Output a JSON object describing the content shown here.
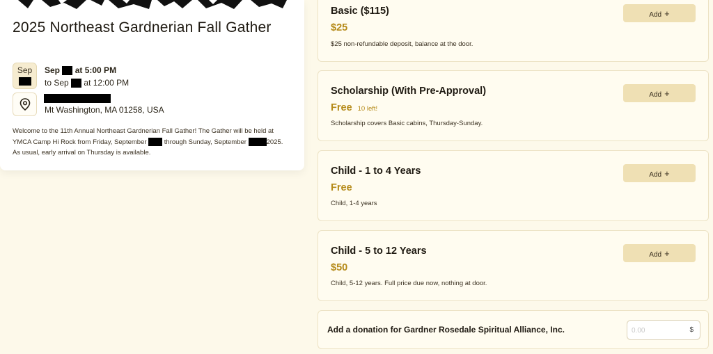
{
  "event": {
    "title": "2025 Northeast Gardnerian Fall Gather",
    "date_month": "Sep",
    "start_prefix": "Sep",
    "start_time": "at 5:00 PM",
    "end_prefix": "to Sep",
    "end_time": "at 12:00 PM",
    "address": "Mt Washington, MA 01258, USA",
    "desc_1": "Welcome to the 11th Annual Northeast Gardnerian Fall Gather! The Gather will be held at YMCA Camp Hi Rock from Friday, September",
    "desc_2": "through Sunday, September",
    "desc_3": "2025. As usual, early arrival on Thursday is available.",
    "icons": {
      "location": "map-pin-icon"
    }
  },
  "tickets": [
    {
      "name": "Basic ($115)",
      "price": "$25",
      "remaining": "",
      "desc": "$25 non-refundable deposit, balance at the door.",
      "add_label": "Add",
      "add_icon": "+"
    },
    {
      "name": "Scholarship (With Pre-Approval)",
      "price": "Free",
      "remaining": "10 left!",
      "desc": "Scholarship covers Basic cabins, Thursday-Sunday.",
      "add_label": "Add",
      "add_icon": "+"
    },
    {
      "name": "Child - 1 to 4 Years",
      "price": "Free",
      "remaining": "",
      "desc": "Child, 1-4 years",
      "add_label": "Add",
      "add_icon": "+"
    },
    {
      "name": "Child - 5 to 12 Years",
      "price": "$50",
      "remaining": "",
      "desc": "Child, 5-12 years. Full price due now, nothing at door.",
      "add_label": "Add",
      "add_icon": "+"
    }
  ],
  "donation": {
    "label": "Add a donation for Gardner Rosedale Spiritual Alliance, Inc.",
    "placeholder": "0.00",
    "currency": "$"
  },
  "colors": {
    "accent": "#b58a18",
    "button_bg": "#efe0b4",
    "page_bg": "#fdf9ea"
  }
}
